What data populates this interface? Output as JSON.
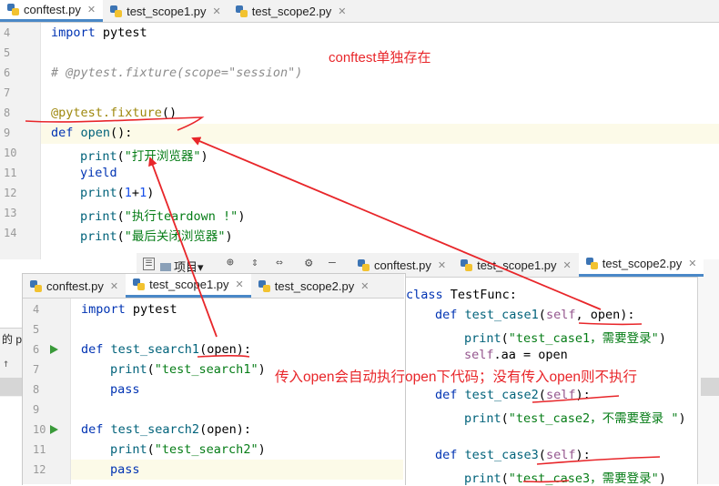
{
  "top_editor": {
    "tabs": [
      {
        "label": "conftest.py",
        "active": true
      },
      {
        "label": "test_scope1.py",
        "active": false
      },
      {
        "label": "test_scope2.py",
        "active": false
      }
    ],
    "lines": [
      {
        "num": "4"
      },
      {
        "num": "5"
      },
      {
        "num": "6"
      },
      {
        "num": "7"
      },
      {
        "num": "8"
      },
      {
        "num": "9"
      },
      {
        "num": "10"
      },
      {
        "num": "11"
      },
      {
        "num": "12"
      },
      {
        "num": "13"
      },
      {
        "num": "14"
      }
    ],
    "code": {
      "import_kw": "import",
      "import_mod": " pytest",
      "comment": "# @pytest.fixture(scope=\"session\")",
      "decorator": "@pytest.fixture",
      "deco_paren": "()",
      "def_kw": "def",
      "fn_name": " open",
      "def_rest": "():",
      "print1_fn": "print",
      "print1_str": "\"打开浏览器\"",
      "yield_kw": "yield",
      "print2_fn": "print",
      "print2_a": "1",
      "print2_op": "+",
      "print2_b": "1",
      "print3_fn": "print",
      "print3_str": "\"执行teardown !\"",
      "print4_fn": "print",
      "print4_str": "\"最后关闭浏览器\""
    }
  },
  "annotations": {
    "conftest_note": "conftest单独存在",
    "open_note": "传入open会自动执行open下代码；没有传入open则不执行"
  },
  "left_editor": {
    "tabs": [
      {
        "label": "conftest.py",
        "active": false
      },
      {
        "label": "test_scope1.py",
        "active": true
      },
      {
        "label": "test_scope2.py",
        "active": false
      }
    ],
    "lines": [
      {
        "num": "4"
      },
      {
        "num": "5"
      },
      {
        "num": "6"
      },
      {
        "num": "7"
      },
      {
        "num": "8"
      },
      {
        "num": "9"
      },
      {
        "num": "10"
      },
      {
        "num": "11"
      },
      {
        "num": "12"
      }
    ],
    "code": {
      "import_kw": "import",
      "import_mod": " pytest",
      "def1_kw": "def",
      "def1_fn": " test_search1",
      "def1_rest": "(open):",
      "print1_fn": "print",
      "print1_str": "\"test_search1\"",
      "pass1": "pass",
      "def2_kw": "def",
      "def2_fn": " test_search2",
      "def2_rest": "(open):",
      "print2_fn": "print",
      "print2_str": "\"test_search2\"",
      "pass2": "pass"
    }
  },
  "right_editor": {
    "toolbar": {
      "project_label": "项目"
    },
    "tabs": [
      {
        "label": "conftest.py",
        "active": false
      },
      {
        "label": "test_scope1.py",
        "active": false
      },
      {
        "label": "test_scope2.py",
        "active": true
      }
    ],
    "code": {
      "class_kw": "class",
      "class_name": " TestFunc:",
      "case1_kw": "def",
      "case1_fn": " test_case1",
      "case1_open": "(",
      "case1_self": "self",
      "case1_rest": ", open):",
      "case1_print": "print",
      "case1_str": "\"test_case1，需要登录\"",
      "aa_self": "self",
      "aa_rest": ".aa = open",
      "case2_kw": "def",
      "case2_fn": " test_case2",
      "case2_open": "(",
      "case2_self": "self",
      "case2_rest": "):",
      "case2_print": "print",
      "case2_str": "\"test_case2，不需要登录 \"",
      "case3_kw": "def",
      "case3_fn": " test_case3",
      "case3_open": "(",
      "case3_self": "self",
      "case3_rest": "):",
      "case3_print": "print",
      "case3_str": "\"test_case3，需要登录\""
    }
  },
  "background": {
    "left_fragment": "的 p"
  },
  "colors": {
    "keyword": "#0033b3",
    "string": "#067d17",
    "annotation_red": "#e8262a",
    "tab_underline": "#4a88c7"
  }
}
